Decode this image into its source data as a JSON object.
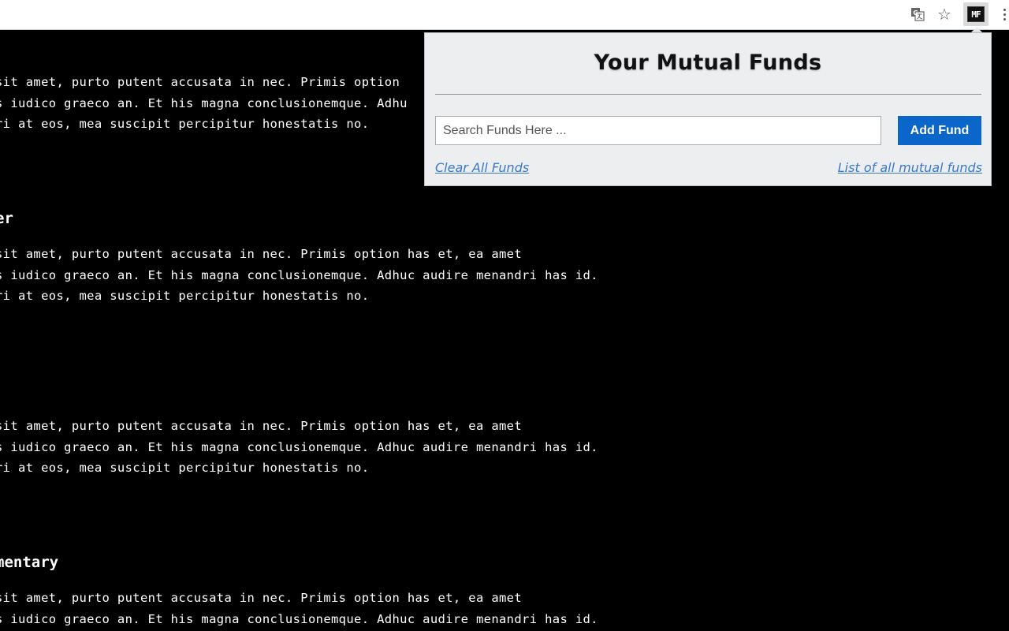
{
  "toolbar": {
    "icons": [
      "translate-icon",
      "bookmark-star-icon",
      "mutual-funds-extension-icon",
      "menu-dots-icon"
    ],
    "extension_badge": "MF"
  },
  "page": {
    "sections": [
      {
        "heading": "",
        "lines": [
          "sit amet, purto putent accusata in nec. Primis option",
          "s iudico graeco an. Et his magna conclusionemque. Adhu",
          "ri at eos, mea suscipit percipitur honestatis no."
        ]
      },
      {
        "heading": "er",
        "lines": [
          "sit amet, purto putent accusata in nec. Primis option has et, ea amet",
          "s iudico graeco an. Et his magna conclusionemque. Adhuc audire menandri has id.",
          "ri at eos, mea suscipit percipitur honestatis no."
        ]
      },
      {
        "heading": "",
        "lines": [
          "sit amet, purto putent accusata in nec. Primis option has et, ea amet",
          "s iudico graeco an. Et his magna conclusionemque. Adhuc audire menandri has id.",
          "ri at eos, mea suscipit percipitur honestatis no."
        ]
      },
      {
        "heading": "mentary",
        "lines": [
          "sit amet, purto putent accusata in nec. Primis option has et, ea amet",
          "s iudico graeco an. Et his magna conclusionemque. Adhuc audire menandri has id."
        ]
      }
    ]
  },
  "popup": {
    "title": "Your Mutual Funds",
    "search": {
      "placeholder": "Search Funds Here ...",
      "value": ""
    },
    "add_button": "Add Fund",
    "clear_link": "Clear All Funds",
    "list_link": "List of all mutual funds",
    "colors": {
      "accent": "#0a66c8",
      "link": "#3a78cf",
      "background": "#eceef0"
    }
  }
}
